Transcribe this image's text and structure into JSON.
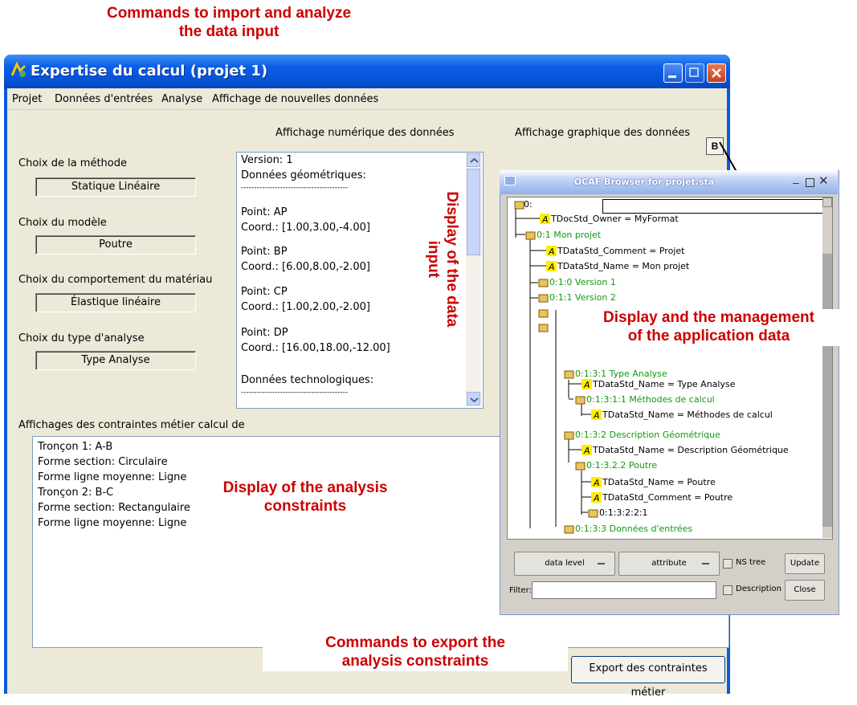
{
  "annotations": {
    "import_line1": "Commands to import and analyze",
    "import_line2": "the data input",
    "data_input_line1": "Display of the data",
    "data_input_line2": "input",
    "app_data_line1": "Display and the management",
    "app_data_line2": "of the application data",
    "constraints_line1": "Display of the analysis",
    "constraints_line2": "constraints",
    "export_line1": "Commands to export the",
    "export_line2": "analysis constraints"
  },
  "window": {
    "title": "Expertise du calcul (projet 1)"
  },
  "menu": [
    "Projet",
    "Données d'entrées",
    "Analyse",
    "Affichage de nouvelles données"
  ],
  "headers": {
    "numeric": "Affichage numérique des données",
    "graphic": "Affichage graphique des données",
    "b_button": "B"
  },
  "choices": {
    "method_label": "Choix de la méthode",
    "method_value": "Statique Linéaire",
    "model_label": "Choix du modèle",
    "model_value": "Poutre",
    "material_label": "Choix du comportement du matériau",
    "material_value": "Élastique linéaire",
    "analysis_label": "Choix du type d'analyse",
    "analysis_value": "Type Analyse"
  },
  "numeric_data": [
    "Version: 1",
    "Données géométriques:",
    "-----------------------------------------",
    "Point: AP",
    "Coord.: [1.00,3.00,-4.00]",
    "Point: BP",
    "Coord.: [6.00,8.00,-2.00]",
    "Point: CP",
    "Coord.: [1.00,2.00,-2.00]",
    "Point: DP",
    "Coord.: [16.00,18.00,-12.00]",
    "Données technologiques:",
    "-----------------------------------------"
  ],
  "constraints": {
    "label": "Affichages des contraintes métier calcul de",
    "lines": [
      "Tronçon 1: A-B",
      "Forme section: Circulaire",
      "Forme ligne moyenne: Ligne",
      "Tronçon 2: B-C",
      "Forme section: Rectangulaire",
      "Forme ligne moyenne: Ligne"
    ]
  },
  "export_button": "Export des contraintes métier",
  "ocaf": {
    "title": "OCAF Browser for projet.sta",
    "tree": [
      "0:",
      "TDocStd_Owner = MyFormat",
      "0:1 Mon projet",
      "TDataStd_Comment = Projet",
      "TDataStd_Name = Mon projet",
      "0:1:0 Version 1",
      "0:1:1 Version 2",
      "0:1:3:1 Type Analyse",
      "TDataStd_Name = Type Analyse",
      "0:1:3:1:1 Méthodes de calcul",
      "TDataStd_Name = Méthodes de calcul",
      "0:1:3:2 Description Géométrique",
      "TDataStd_Name = Description Géométrique",
      "0:1:3.2.2 Poutre",
      "TDataStd_Name = Poutre",
      "TDataStd_Comment = Poutre",
      "0:1:3:2:2:1",
      "0:1:3:3 Données d'entrées"
    ],
    "data_level": "data level",
    "attribute": "attribute",
    "ns_tree": "NS tree",
    "update": "Update",
    "filter_label": "Filter:",
    "description": "Description",
    "close": "Close"
  }
}
